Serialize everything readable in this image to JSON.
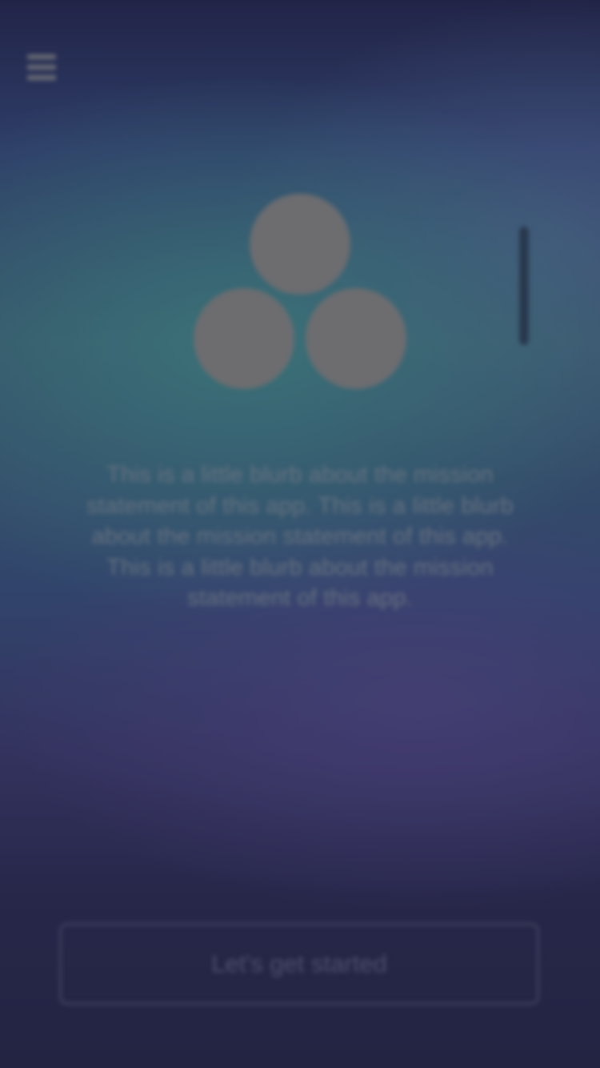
{
  "menu": {
    "icon": "hamburger-menu-icon"
  },
  "hero": {
    "logo_icon": "three-circles-logo-icon"
  },
  "blurb": {
    "text": "This is a little blurb about the mission statement of this app. This is a little blurb about the mission statement of this app. This is a little blurb about the mission statement of this app."
  },
  "cta": {
    "label": "Let's get started"
  },
  "colors": {
    "background_top": "#25284f",
    "background_teal": "#3e6277",
    "background_purple": "#3b3a6c",
    "logo_gray": "#808080",
    "button_border": "#4a4b6d"
  }
}
